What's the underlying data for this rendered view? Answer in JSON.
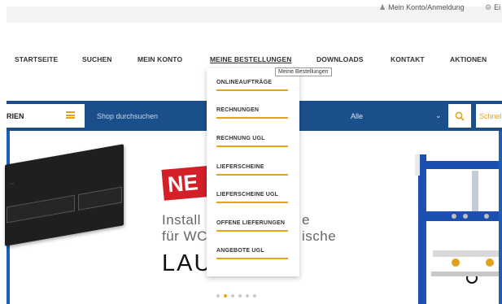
{
  "topbar": {
    "account_label": "Mein Konto/Anmeldung",
    "second_label": "Ei"
  },
  "nav": {
    "items": [
      {
        "label": "STARTSEITE"
      },
      {
        "label": "SUCHEN"
      },
      {
        "label": "MEIN KONTO"
      },
      {
        "label": "MEINE BESTELLUNGEN"
      },
      {
        "label": "DOWNLOADS"
      },
      {
        "label": "KONTAKT"
      },
      {
        "label": "AKTIONEN"
      }
    ],
    "tooltip": "Meine Bestellungen"
  },
  "dropdown": {
    "items": [
      {
        "label": "ONLINEAUFTRÄGE"
      },
      {
        "label": "RECHNUNGEN"
      },
      {
        "label": "RECHNUNG UGL"
      },
      {
        "label": "LIEFERSCHEINE"
      },
      {
        "label": "LIEFERSCHEINE UGL"
      },
      {
        "label": "OFFENE LIEFERUNGEN"
      },
      {
        "label": "ANGEBOTE UGL"
      }
    ]
  },
  "searchbar": {
    "category_label": "RIEN",
    "placeholder": "Shop durchsuchen",
    "select_value": "Alle",
    "quick_label": "Schnel"
  },
  "hero": {
    "badge": "NE",
    "line1": "Install",
    "line1_tail": "e",
    "line2": "für WC",
    "line2_tail": "ische",
    "brand": "LAU",
    "slides_total": 6,
    "active_slide": 2
  },
  "colors": {
    "accent": "#e6a21a",
    "bar_blue": "#1b4f8c",
    "badge_red": "#d41f28"
  }
}
